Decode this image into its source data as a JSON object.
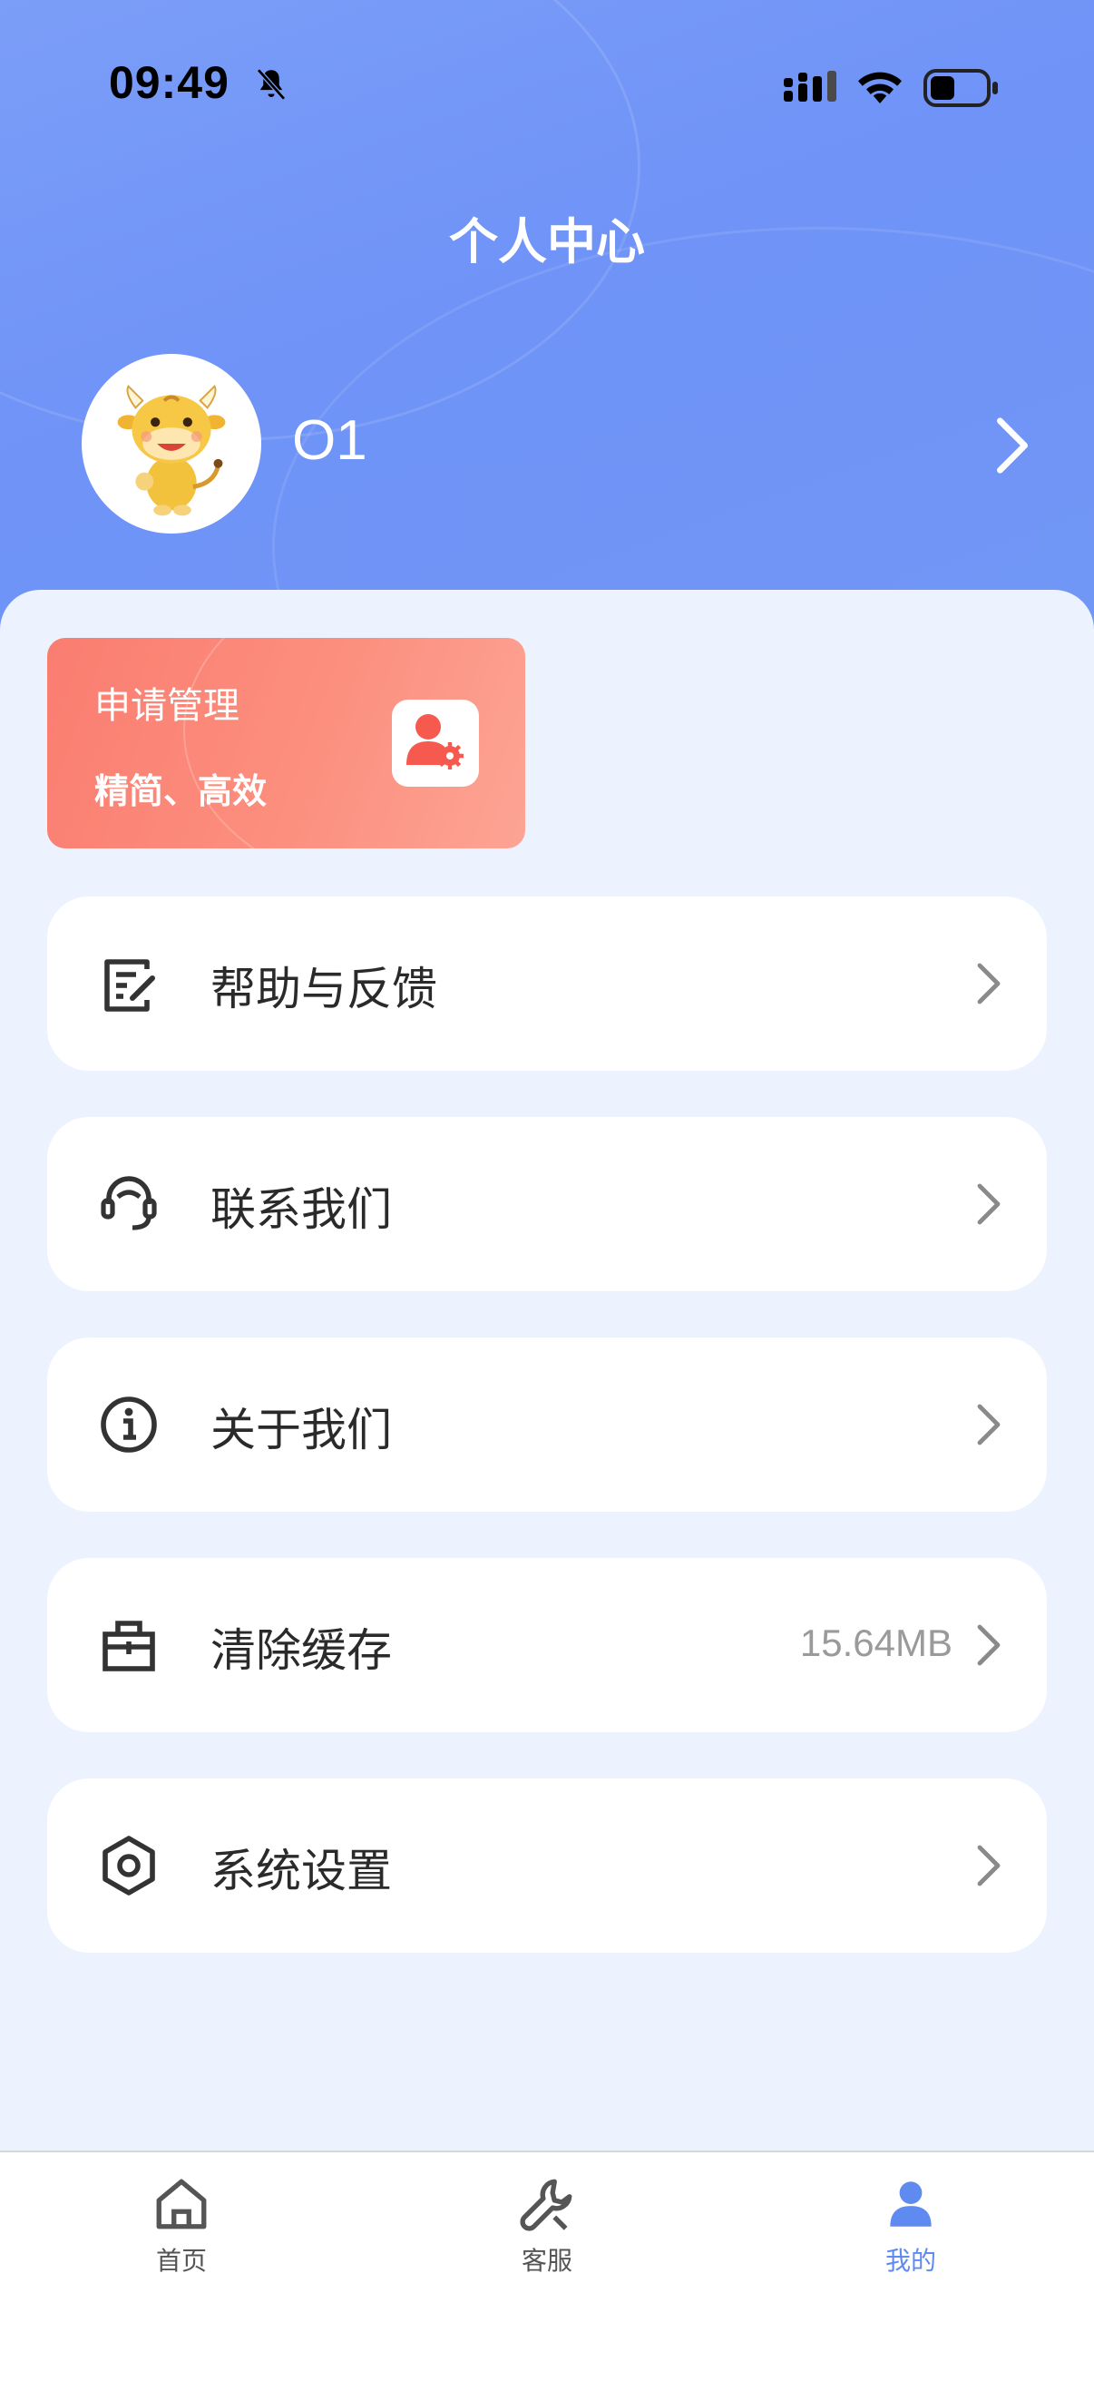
{
  "status_bar": {
    "time": "09:49"
  },
  "header": {
    "title": "个人中心"
  },
  "profile": {
    "username": "O1",
    "avatar_icon": "cow-mascot-avatar"
  },
  "apply_card": {
    "title": "申请管理",
    "subtitle": "精简、高效",
    "icon": "user-gear-icon"
  },
  "menu": [
    {
      "label": "帮助与反馈",
      "icon": "feedback-edit-icon",
      "value": ""
    },
    {
      "label": "联系我们",
      "icon": "headset-icon",
      "value": ""
    },
    {
      "label": "关于我们",
      "icon": "info-icon",
      "value": ""
    },
    {
      "label": "清除缓存",
      "icon": "clear-cache-icon",
      "value": "15.64MB"
    },
    {
      "label": "系统设置",
      "icon": "settings-gear-icon",
      "value": ""
    }
  ],
  "tabbar": [
    {
      "label": "首页",
      "icon": "home-icon",
      "active": false
    },
    {
      "label": "客服",
      "icon": "wrench-icon",
      "active": false
    },
    {
      "label": "我的",
      "icon": "person-icon",
      "active": true
    }
  ],
  "colors": {
    "primary": "#6f93f7",
    "accent_card": "#fa7d70",
    "active_tab": "#5f8bf1",
    "page_bg": "#ecf2fe"
  }
}
